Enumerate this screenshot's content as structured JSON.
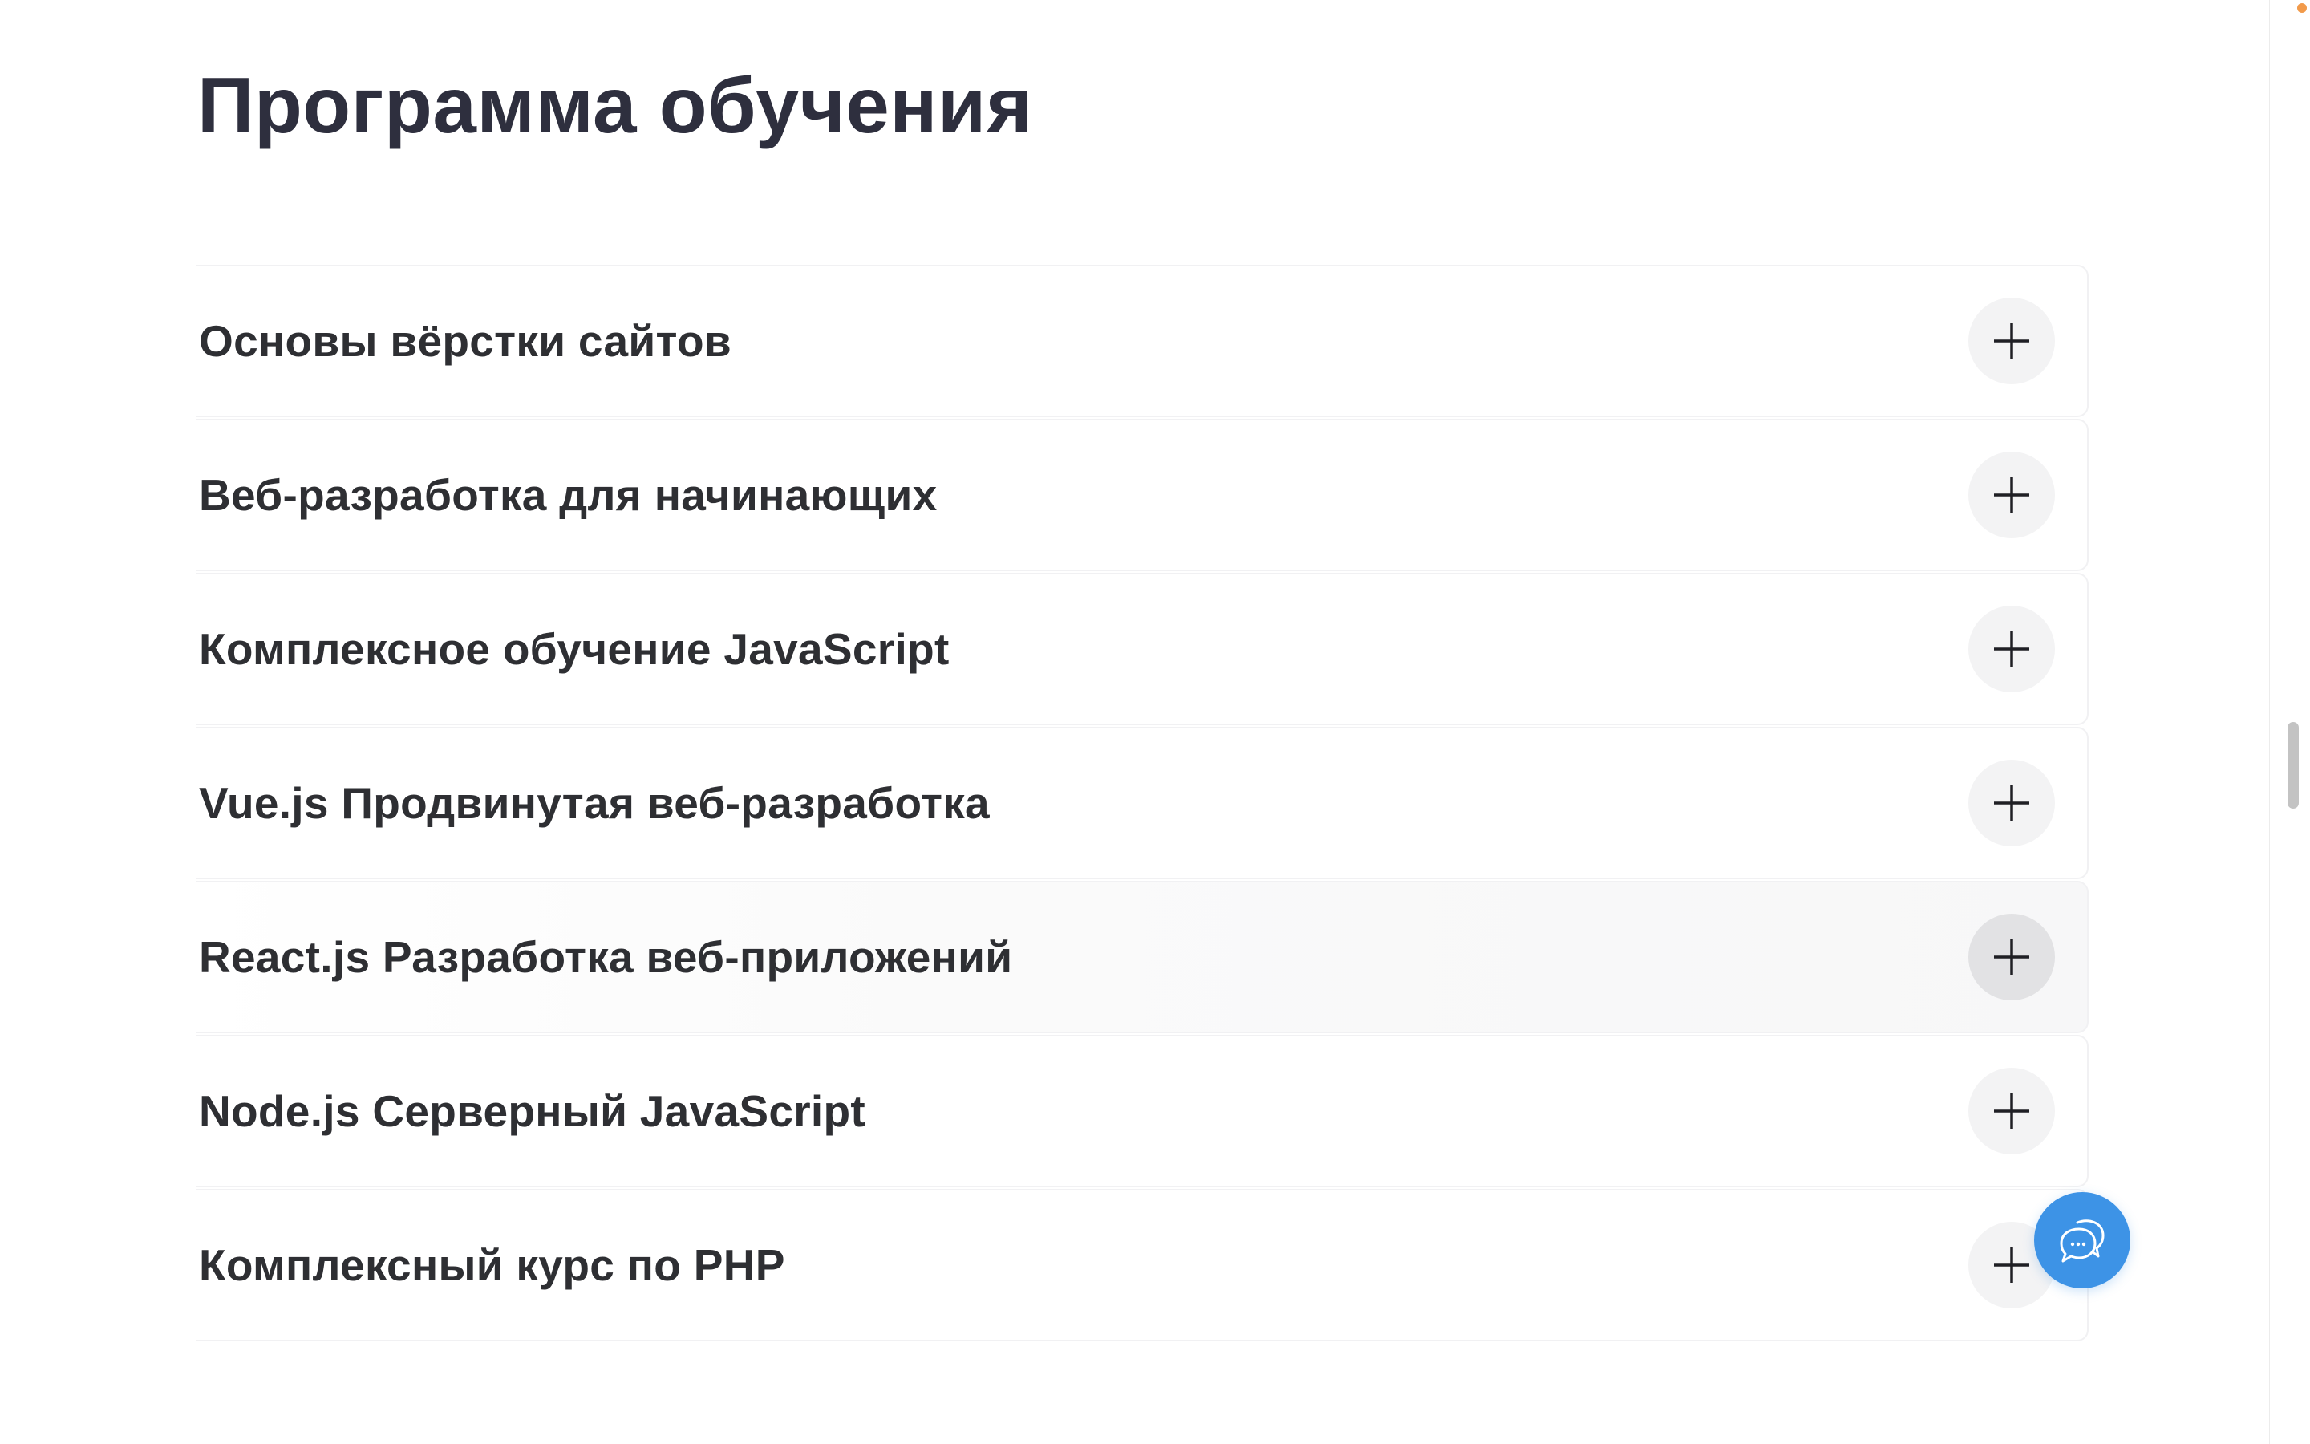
{
  "section": {
    "title": "Программа обучения"
  },
  "accordion": {
    "items": [
      {
        "label": "Основы вёрстки сайтов"
      },
      {
        "label": "Веб-разработка для начинающих"
      },
      {
        "label": "Комплексное обучение JavaScript"
      },
      {
        "label": "Vue.js Продвинутая веб-разработка"
      },
      {
        "label": "React.js Разработка веб-приложений"
      },
      {
        "label": "Node.js Серверный JavaScript"
      },
      {
        "label": "Комплексный курс по PHP"
      }
    ],
    "toggle_icon": "plus-icon",
    "hovered_index": 4
  },
  "chat_widget": {
    "icon": "chat-bubbles-icon",
    "color": "#3d93e6"
  },
  "colors": {
    "heading": "#2e2f3e",
    "text": "#2e2f33",
    "toggle_bg": "#f3f3f4",
    "toggle_bg_hover": "#e2e2e4",
    "border": "#f1f1f3"
  }
}
